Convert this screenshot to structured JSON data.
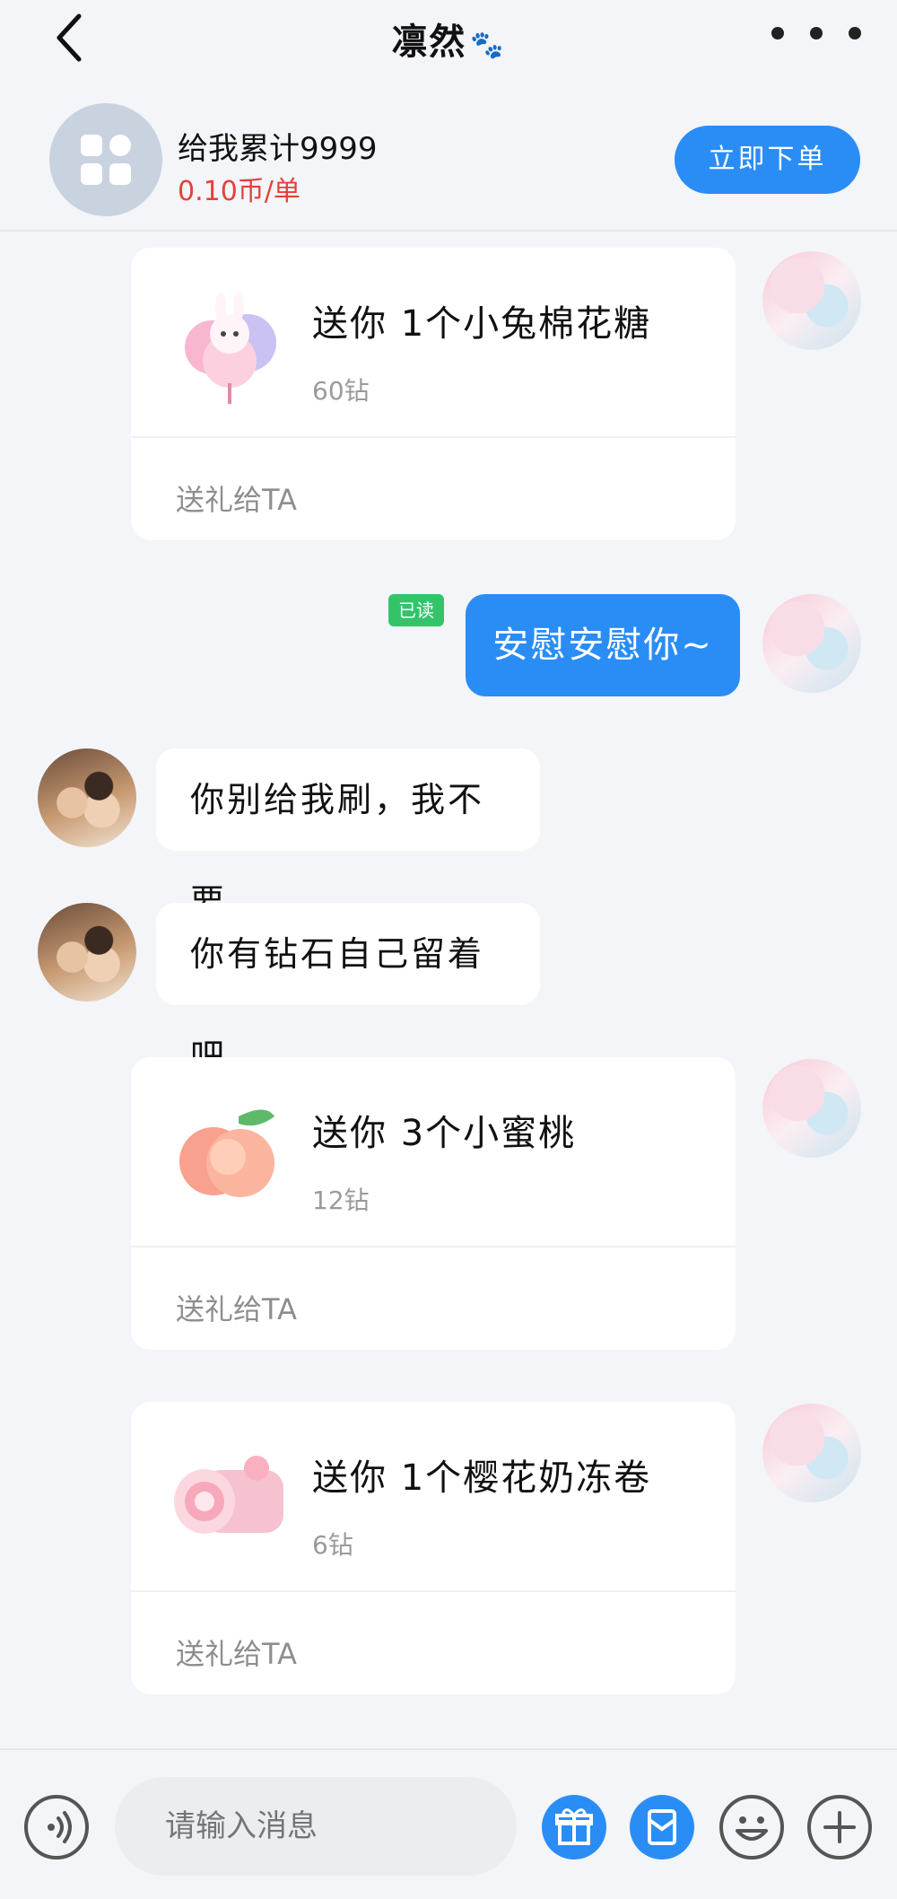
{
  "header": {
    "title": "凛然",
    "title_emoji": "🐾"
  },
  "order": {
    "title": "给我累计9999",
    "price": "0.10币/单",
    "button_label": "立即下单"
  },
  "gifts": [
    {
      "title": "送你 1个小兔棉花糖",
      "price": "60钻",
      "action": "送礼给TA"
    },
    {
      "title": "送你 3个小蜜桃",
      "price": "12钻",
      "action": "送礼给TA"
    },
    {
      "title": "送你 1个樱花奶冻卷",
      "price": "6钻",
      "action": "送礼给TA"
    }
  ],
  "messages": {
    "sent_1": "安慰安慰你~",
    "read_status": "已读",
    "recv_1": "你别给我刷，我不要",
    "recv_2": "你有钻石自己留着吧"
  },
  "input": {
    "placeholder": "请输入消息"
  },
  "colors": {
    "accent": "#2a8df6",
    "price_red": "#e4413a",
    "read_green": "#33c46a",
    "background": "#f3f5f8"
  },
  "icons": [
    "back-icon",
    "more-icon",
    "grid-icon",
    "voice-icon",
    "gift-icon",
    "red-packet-icon",
    "emoji-icon",
    "plus-icon"
  ]
}
